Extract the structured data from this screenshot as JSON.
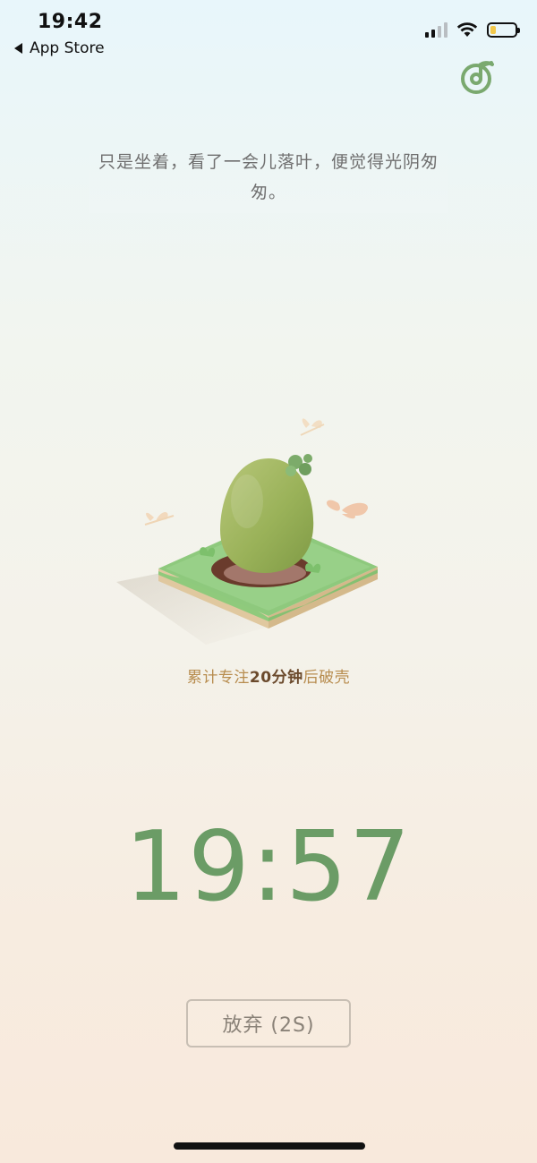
{
  "status_bar": {
    "time": "19:42",
    "back_label": "App Store",
    "battery_color": "#f2c84b"
  },
  "header": {
    "music_icon": "music-note-circle-icon",
    "accent": "#7aa96f"
  },
  "quote": {
    "text": "只是坐着，看了一会儿落叶，便觉得光阴匆匆。"
  },
  "pet": {
    "illustration": "egg-on-grass-tile"
  },
  "hatch_info": {
    "prefix": "累计专注",
    "duration": "20分钟",
    "suffix": "后破壳"
  },
  "timer": {
    "value": "19:57",
    "color": "#6b9c66"
  },
  "actions": {
    "give_up_label": "放弃 (2S)"
  }
}
